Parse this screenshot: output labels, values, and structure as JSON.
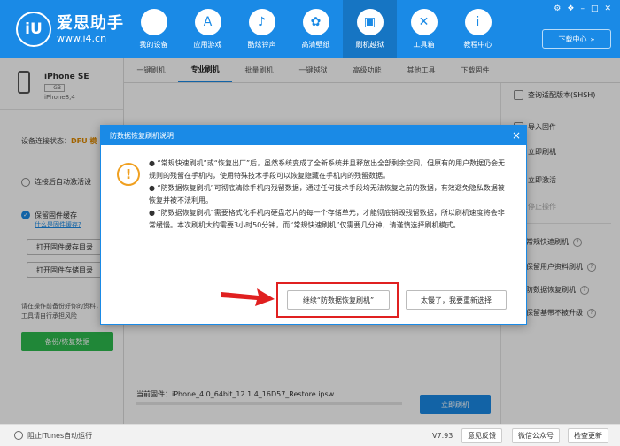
{
  "app": {
    "name": "爱思助手",
    "url": "www.i4.cn",
    "logo_text": "iU"
  },
  "nav": [
    {
      "label": "我的设备",
      "icon": "apple-icon",
      "glyph": ""
    },
    {
      "label": "应用游戏",
      "icon": "appstore-icon",
      "glyph": "A"
    },
    {
      "label": "酷炫铃声",
      "icon": "bell-icon",
      "glyph": "♪"
    },
    {
      "label": "高清壁纸",
      "icon": "flower-icon",
      "glyph": "✿"
    },
    {
      "label": "刷机越狱",
      "icon": "box-icon",
      "glyph": "▣"
    },
    {
      "label": "工具箱",
      "icon": "tools-icon",
      "glyph": "✕"
    },
    {
      "label": "教程中心",
      "icon": "info-icon",
      "glyph": "i"
    }
  ],
  "window_controls": {
    "settings": "⚙",
    "skin": "❖",
    "minimize": "–",
    "maximize": "□",
    "close": "✕"
  },
  "download_center": {
    "label": "下载中心",
    "chevron": "»"
  },
  "device": {
    "name": "iPhone SE",
    "capacity": "-- GB",
    "model": "iPhone8,4"
  },
  "left": {
    "connection_label": "设备连接状态：",
    "connection_status": "DFU 模",
    "auto_activate": "连接后自动激活设",
    "keep_firmware": "保留固件缓存",
    "what_is_cache": "什么是固件缓存?",
    "open_cache_dir": "打开固件缓存目录",
    "open_storage_dir": "打开固件存储目录",
    "warning": "请在操作前备份好你的资料，使用本工具请自行承担风险",
    "backup_button": "备份/恢复数据",
    "check_mark": "✓"
  },
  "tabs": [
    "一键刷机",
    "专业刷机",
    "批量刷机",
    "一键越狱",
    "高级功能",
    "其他工具",
    "下载固件"
  ],
  "content": {
    "firmware_label": "当前固件：",
    "firmware_file": "iPhone_4.0_64bit_12.1.4_16D57_Restore.ipsw",
    "flash_button": "立即刷机"
  },
  "right": {
    "query_shsh": "查询适配版本(SHSH)",
    "import_firmware": "导入固件",
    "flash_now": "立即刷机",
    "activate_now": "立即激活",
    "stop": "停止操作",
    "mode_normal": "常规快速刷机",
    "mode_keep_data": "保留用户资料刷机",
    "mode_anti_recovery": "防数据恢复刷机",
    "mode_keep_baseband": "保留基带不被升级",
    "help": "?"
  },
  "dialog": {
    "title": "防数据恢复刷机说明",
    "close": "×",
    "warn_glyph": "!",
    "paragraphs": [
      "●  “常规快速刷机”或“恢复出厂”后，虽然系统变成了全新系统并且释放出全部剩余空间，但原有的用户数据仍会无规则的残留在手机内，使用特殊技术手段可以恢复隐藏在手机内的残留数据。",
      "●  “防数据恢复刷机”可彻底清除手机内残留数据，通过任何技术手段均无法恢复之前的数据，有效避免隐私数据被恢复并被不法利用。",
      "●  “防数据恢复刷机”需要格式化手机内硬盘芯片的每一个存储单元，才能彻底销毁残留数据，所以刷机速度将会非常缓慢。本次刷机大约需要3小时50分钟，而“常规快速刷机”仅需要几分钟，请谨慎选择刷机模式。"
    ],
    "continue_button": "继续“防数据恢复刷机”",
    "reselect_button": "太慢了，我要重新选择"
  },
  "statusbar": {
    "block_itunes": "阻止iTunes自动运行",
    "version": "V7.93",
    "feedback": "意见反馈",
    "wechat": "微信公众号",
    "check_update": "检查更新"
  }
}
